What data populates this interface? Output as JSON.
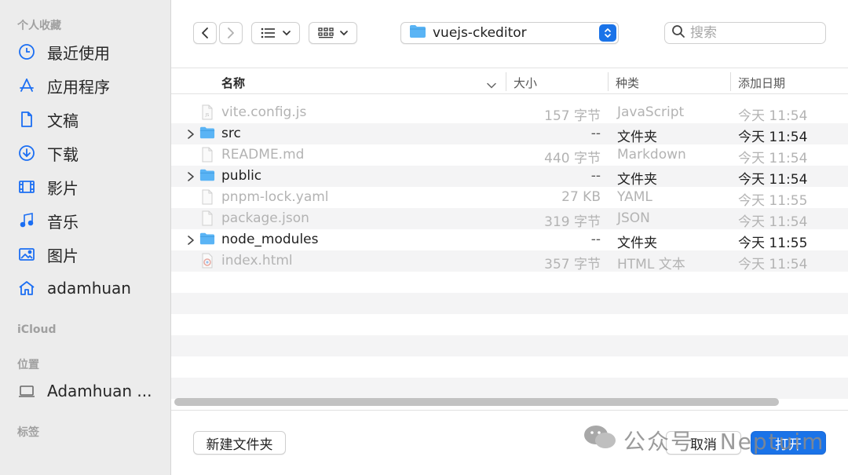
{
  "sidebar": {
    "favorites_header": "个人收藏",
    "favorites": [
      {
        "label": "最近使用",
        "icon": "clock-icon"
      },
      {
        "label": "应用程序",
        "icon": "apps-icon"
      },
      {
        "label": "文稿",
        "icon": "document-icon"
      },
      {
        "label": "下载",
        "icon": "download-icon"
      },
      {
        "label": "影片",
        "icon": "film-icon"
      },
      {
        "label": "音乐",
        "icon": "music-icon"
      },
      {
        "label": "图片",
        "icon": "photo-icon"
      },
      {
        "label": "adamhuan",
        "icon": "home-icon"
      }
    ],
    "icloud_header": "iCloud",
    "locations_header": "位置",
    "locations": [
      {
        "label": "Adamhuan ...",
        "icon": "laptop-icon"
      }
    ],
    "tags_header": "标签"
  },
  "toolbar": {
    "path_label": "vuejs-ckeditor",
    "search_placeholder": "搜索"
  },
  "columns": {
    "name": "名称",
    "size": "大小",
    "kind": "种类",
    "date": "添加日期"
  },
  "files": [
    {
      "name": "vite.config.js",
      "size": "157 字节",
      "kind": "JavaScript",
      "date": "今天 11:54",
      "type": "file",
      "icon": "js-file-icon",
      "enabled": false
    },
    {
      "name": "src",
      "size": "--",
      "kind": "文件夹",
      "date": "今天 11:54",
      "type": "folder",
      "icon": "folder-icon",
      "enabled": true
    },
    {
      "name": "README.md",
      "size": "440 字节",
      "kind": "Markdown",
      "date": "今天 11:54",
      "type": "file",
      "icon": "file-icon",
      "enabled": false
    },
    {
      "name": "public",
      "size": "--",
      "kind": "文件夹",
      "date": "今天 11:54",
      "type": "folder",
      "icon": "folder-icon",
      "enabled": true
    },
    {
      "name": "pnpm-lock.yaml",
      "size": "27 KB",
      "kind": "YAML",
      "date": "今天 11:55",
      "type": "file",
      "icon": "file-icon",
      "enabled": false
    },
    {
      "name": "package.json",
      "size": "319 字节",
      "kind": "JSON",
      "date": "今天 11:54",
      "type": "file",
      "icon": "file-icon",
      "enabled": false
    },
    {
      "name": "node_modules",
      "size": "--",
      "kind": "文件夹",
      "date": "今天 11:55",
      "type": "folder",
      "icon": "folder-icon",
      "enabled": true
    },
    {
      "name": "index.html",
      "size": "357 字节",
      "kind": "HTML 文本",
      "date": "今天 11:54",
      "type": "file",
      "icon": "chrome-file-icon",
      "enabled": false
    }
  ],
  "buttons": {
    "new_folder": "新建文件夹",
    "cancel": "取消",
    "open": "打开"
  },
  "watermark": {
    "text": "公众号 · Neptuim"
  },
  "colors": {
    "accent": "#1a73e8",
    "sidebar_bg": "#ececec",
    "folder": "#5ab4f5"
  }
}
